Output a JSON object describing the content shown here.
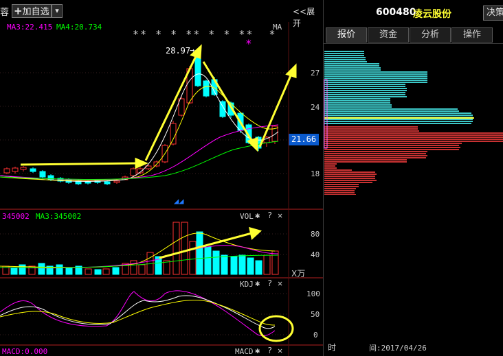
{
  "toolbar": {
    "left_char": "蓉",
    "add_label": "加自选",
    "add_glyph": "+",
    "dropdown_glyph": "▾",
    "expand_label": "<<展开"
  },
  "main_chart": {
    "ma3_label": "MA3:22.415",
    "ma4_label": "MA4:20.734",
    "ma_tag": "MA",
    "stars": "** * * ** * * **  *",
    "pink_star": "*",
    "high_label": "28.97",
    "high_arrow": "→",
    "price_ticks": [
      "27",
      "24",
      "18"
    ],
    "current_price": "21.66",
    "markers": "◢◢"
  },
  "vol_panel": {
    "vol_label": "345002",
    "ma3_label": "MA3:345002",
    "name": "VOL",
    "ticks": [
      "80",
      "40"
    ],
    "unit": "X万"
  },
  "kdj_panel": {
    "name": "KDJ",
    "ticks": [
      "100",
      "50",
      "0"
    ]
  },
  "macd_panel": {
    "value_label": "MACD:0.000",
    "name": "MACD"
  },
  "panel_icons": {
    "gear": "✱",
    "help": "?",
    "close": "✕"
  },
  "stock": {
    "code": "600480",
    "name": "凌云股份",
    "decision_btn": "决策"
  },
  "tabs": [
    "报价",
    "资金",
    "分析",
    "操作"
  ],
  "footer": {
    "time_label": "时",
    "date_label": "间:2017/04/26"
  },
  "colors": {
    "up": "#ff3232",
    "down": "#00ffff",
    "ma_white": "#ffffff",
    "ma_yellow": "#ffff00",
    "ma_magenta": "#ff00ff",
    "ma_green": "#00ff00",
    "highlight": "#0a5acd",
    "profile_up": "#c83232",
    "profile_down": "#3cc8c8"
  }
}
